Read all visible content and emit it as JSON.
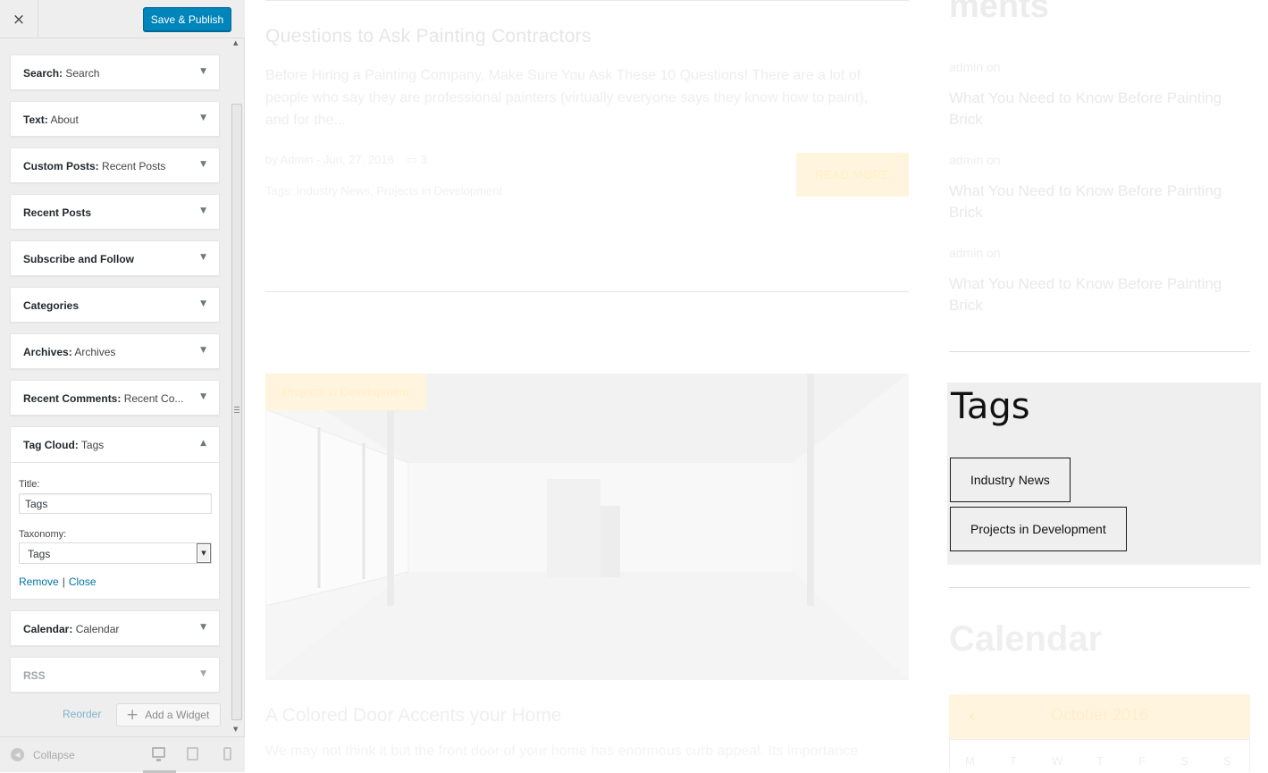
{
  "customizer": {
    "close_icon": "×",
    "publish_label": "Save & Publish",
    "widgets": [
      {
        "type": "Search:",
        "name": "Search"
      },
      {
        "type": "Text:",
        "name": "About"
      },
      {
        "type": "Custom Posts:",
        "name": "Recent Posts"
      },
      {
        "type": "Recent Posts",
        "name": ""
      },
      {
        "type": "Subscribe and Follow",
        "name": ""
      },
      {
        "type": "Categories",
        "name": ""
      },
      {
        "type": "Archives:",
        "name": "Archives"
      },
      {
        "type": "Recent Comments:",
        "name": "Recent Co..."
      }
    ],
    "tag_cloud": {
      "type": "Tag Cloud:",
      "name": "Tags",
      "title_label": "Title:",
      "title_value": "Tags",
      "taxonomy_label": "Taxonomy:",
      "taxonomy_value": "Tags",
      "remove_label": "Remove",
      "separator": "|",
      "close_label": "Close"
    },
    "widgets_after": [
      {
        "type": "Calendar:",
        "name": "Calendar"
      },
      {
        "type": "RSS",
        "name": ""
      }
    ],
    "reorder_label": "Reorder",
    "add_widget_label": "Add a Widget",
    "collapse_label": "Collapse",
    "arrow_down": "▼",
    "arrow_up": "▲"
  },
  "preview": {
    "post1": {
      "title": "Questions to Ask Painting Contractors",
      "excerpt": "Before Hiring a Painting Company, Make Sure You Ask These 10 Questions! There are a lot of people who say they are professional painters (virtually everyone says they know how to paint), and for the...",
      "meta": "by Admin - Jun, 27, 2016",
      "comments": "3",
      "tags": "Tags: Industry News, Projects in Development",
      "read_more": "READ MORE"
    },
    "post2": {
      "badge": "Projects in Development",
      "title": "A Colored Door Accents your Home",
      "excerpt": "We may not think it but the front door of your home has enormous curb appeal. Its importance"
    },
    "sidebar": {
      "comments_heading": "ments",
      "comments": [
        {
          "author": "admin on",
          "link": "What You Need to Know Before Painting Brick"
        },
        {
          "author": "admin on",
          "link": "What You Need to Know Before Painting Brick"
        },
        {
          "author": "admin on",
          "link": "What You Need to Know Before Painting Brick"
        }
      ],
      "tags_heading": "Tags",
      "tags": [
        "Industry News",
        "Projects in Development"
      ],
      "calendar_heading": "Calendar",
      "calendar_month": "October 2016",
      "calendar_prev": "‹",
      "weekdays": [
        "M",
        "T",
        "W",
        "T",
        "F",
        "S",
        "S"
      ]
    }
  }
}
